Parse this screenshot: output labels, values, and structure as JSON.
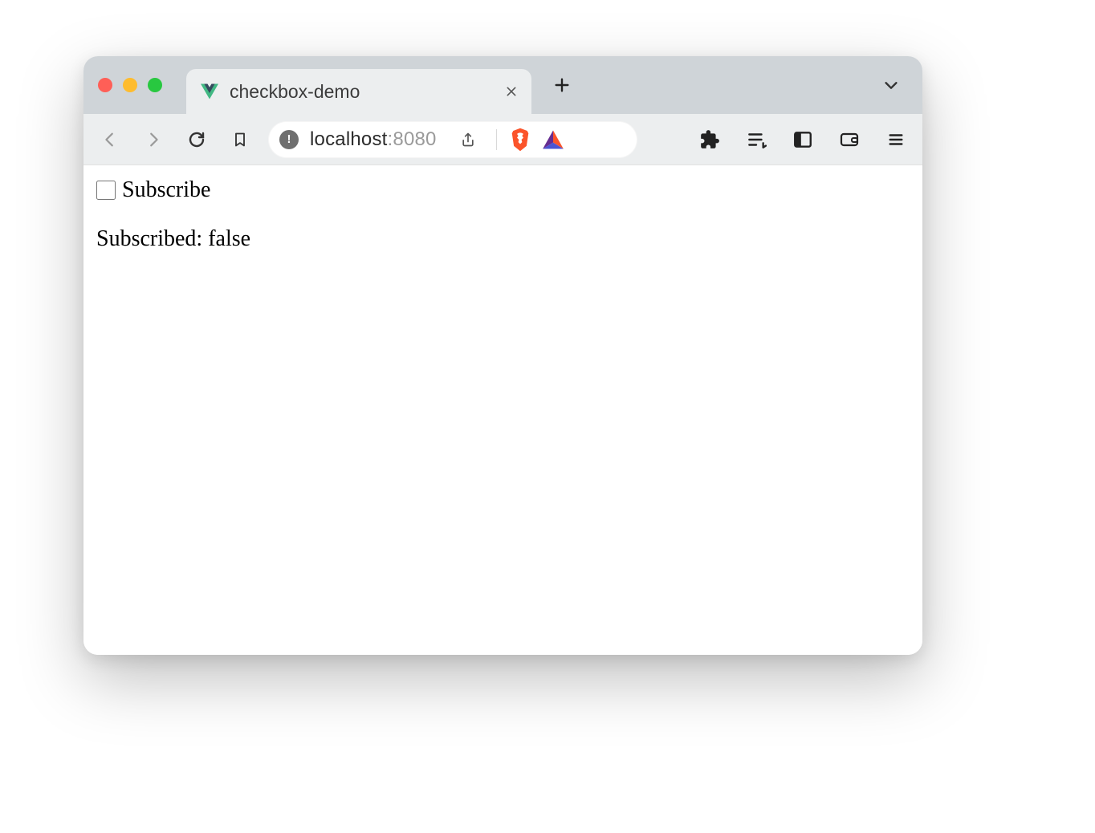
{
  "window": {
    "traffic_lights": [
      "close",
      "minimize",
      "maximize"
    ]
  },
  "tab": {
    "title": "checkbox-demo",
    "favicon": "vue-logo-icon"
  },
  "toolbar": {
    "back": "Back",
    "forward": "Forward",
    "reload": "Reload",
    "bookmark": "Bookmark",
    "share": "Share",
    "extensions": "Extensions",
    "reading_list": "Reading list",
    "panel": "Side panel",
    "wallet": "Wallet",
    "menu": "Menu"
  },
  "address": {
    "scheme_icon": "not-secure",
    "host": "localhost",
    "port": ":8080"
  },
  "page": {
    "checkbox_label": "Subscribe",
    "checkbox_checked": false,
    "status_prefix": "Subscribed: ",
    "status_value": "false"
  },
  "colors": {
    "tabstrip": "#CFD4D8",
    "toolbar": "#ECEEEF",
    "vue_green": "#41B883",
    "vue_dark": "#35495E",
    "brave_orange": "#FB542B"
  }
}
